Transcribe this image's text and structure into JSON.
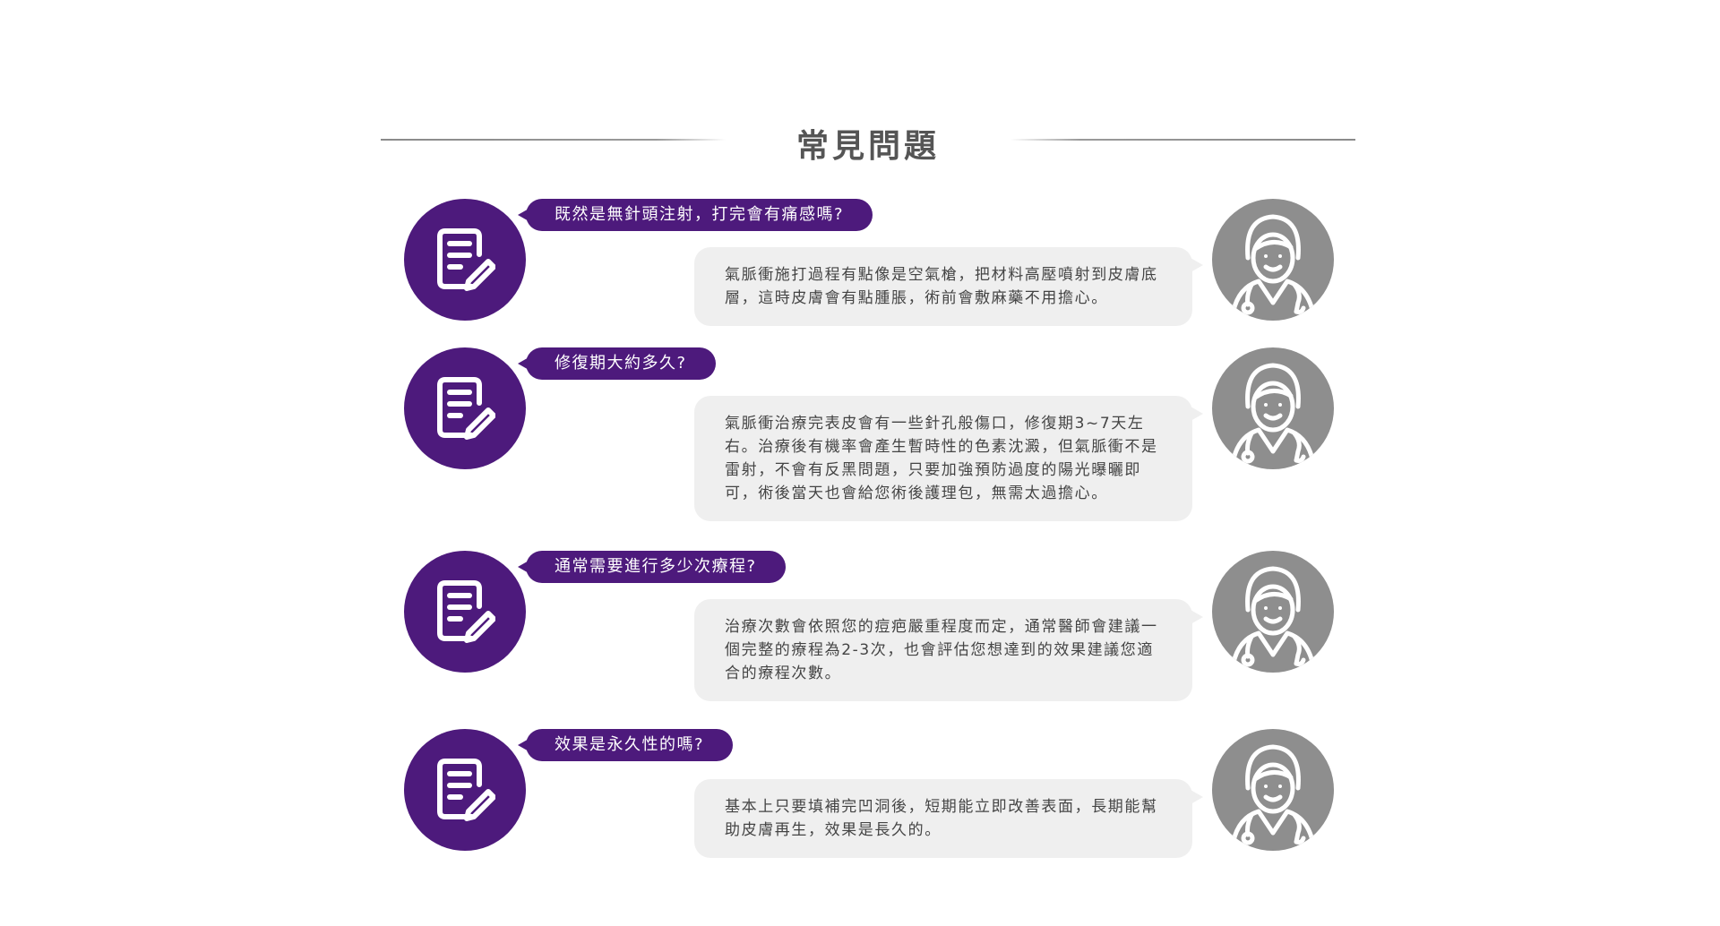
{
  "page": {
    "title": "常見問題"
  },
  "colors": {
    "question_purple": "#4d1a7c",
    "answer_bg": "#efefef",
    "doctor_gray": "#8e8e8e"
  },
  "icons": {
    "question_avatar": "document-edit-icon",
    "answer_avatar": "doctor-icon"
  },
  "faq": [
    {
      "question": "既然是無針頭注射，打完會有痛感嗎?",
      "answer": "氣脈衝施打過程有點像是空氣槍，把材料高壓噴射到皮膚底層，這時皮膚會有點腫脹，術前會敷麻藥不用擔心。"
    },
    {
      "question": "修復期大約多久?",
      "answer": "氣脈衝治療完表皮會有一些針孔般傷口，修復期3~7天左右。治療後有機率會產生暫時性的色素沈澱，但氣脈衝不是雷射，不會有反黑問題，只要加強預防過度的陽光曝曬即可，術後當天也會給您術後護理包，無需太過擔心。"
    },
    {
      "question": "通常需要進行多少次療程?",
      "answer": "治療次數會依照您的痘疤嚴重程度而定，通常醫師會建議一個完整的療程為2-3次，也會評估您想達到的效果建議您適合的療程次數。"
    },
    {
      "question": "效果是永久性的嗎?",
      "answer": "基本上只要填補完凹洞後，短期能立即改善表面，長期能幫助皮膚再生，效果是長久的。"
    }
  ]
}
